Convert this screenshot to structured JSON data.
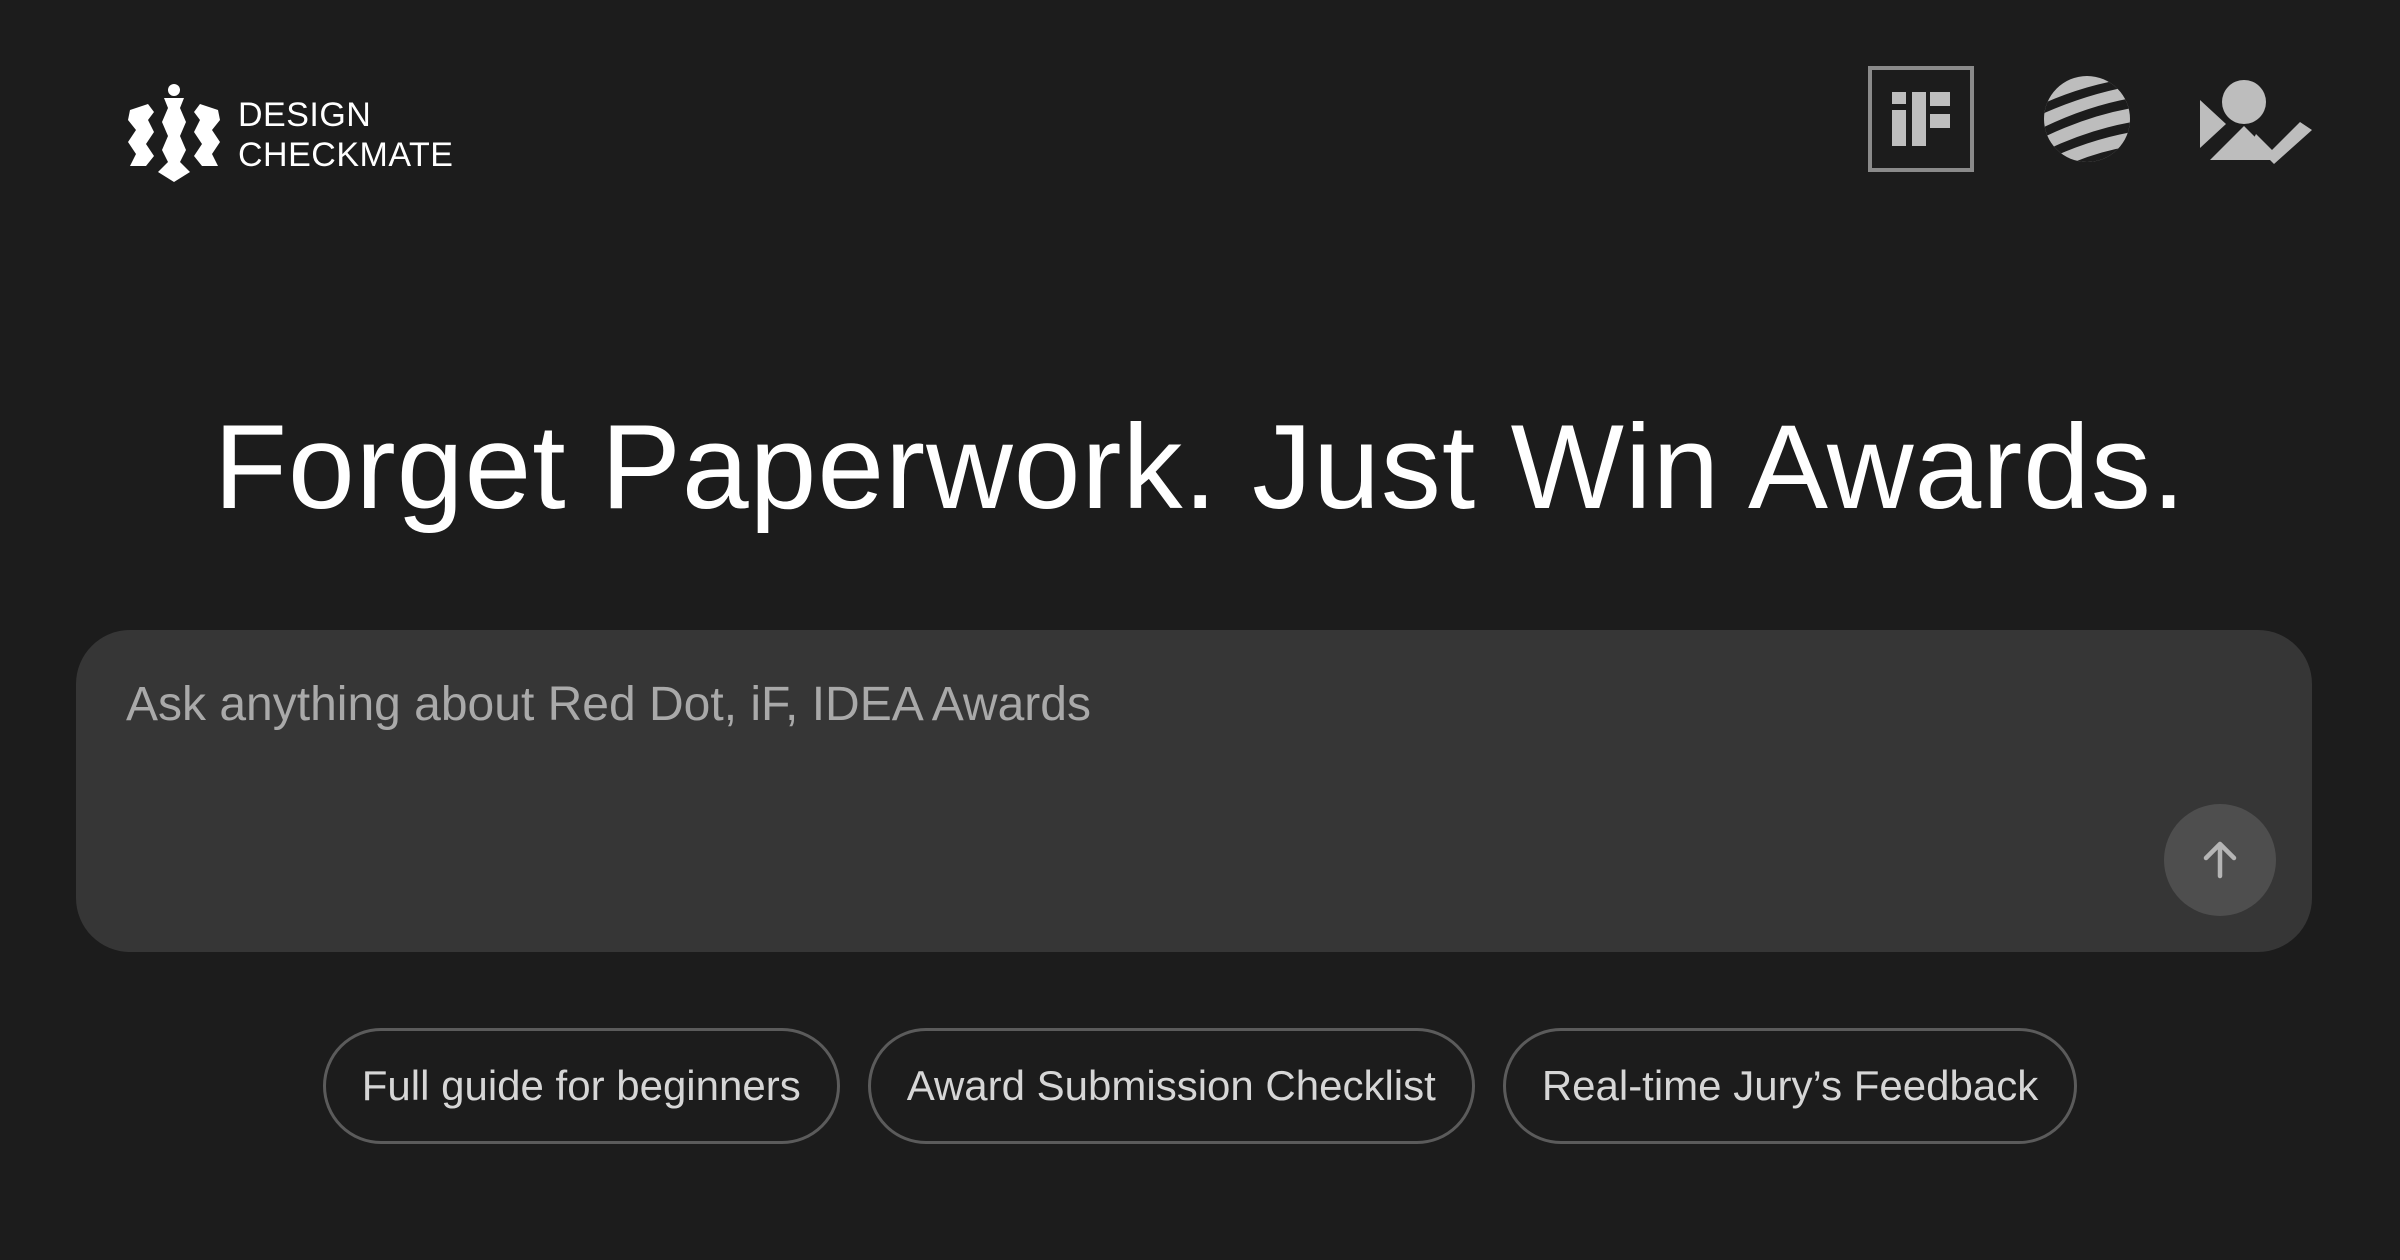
{
  "brand": {
    "line1": "DESIGN",
    "line2": "CHECKMATE"
  },
  "partners": [
    {
      "name": "iF",
      "icon": "if-award-icon"
    },
    {
      "name": "Red Dot",
      "icon": "red-dot-icon"
    },
    {
      "name": "IDEA",
      "icon": "idea-award-icon"
    }
  ],
  "hero": {
    "title": "Forget Paperwork. Just Win Awards."
  },
  "prompt": {
    "placeholder": "Ask anything about Red Dot, iF, IDEA Awards",
    "value": "",
    "send_icon": "arrow-up-icon"
  },
  "suggestions": [
    {
      "label": "Full guide for beginners"
    },
    {
      "label": "Award Submission Checklist"
    },
    {
      "label": "Real-time Jury’s Feedback"
    }
  ],
  "colors": {
    "background": "#1c1c1c",
    "input_background": "#363636",
    "send_button": "#4e4e4e",
    "chip_border": "#5b5b5b",
    "text": "#ffffff",
    "muted_text": "#a9a9a9"
  }
}
